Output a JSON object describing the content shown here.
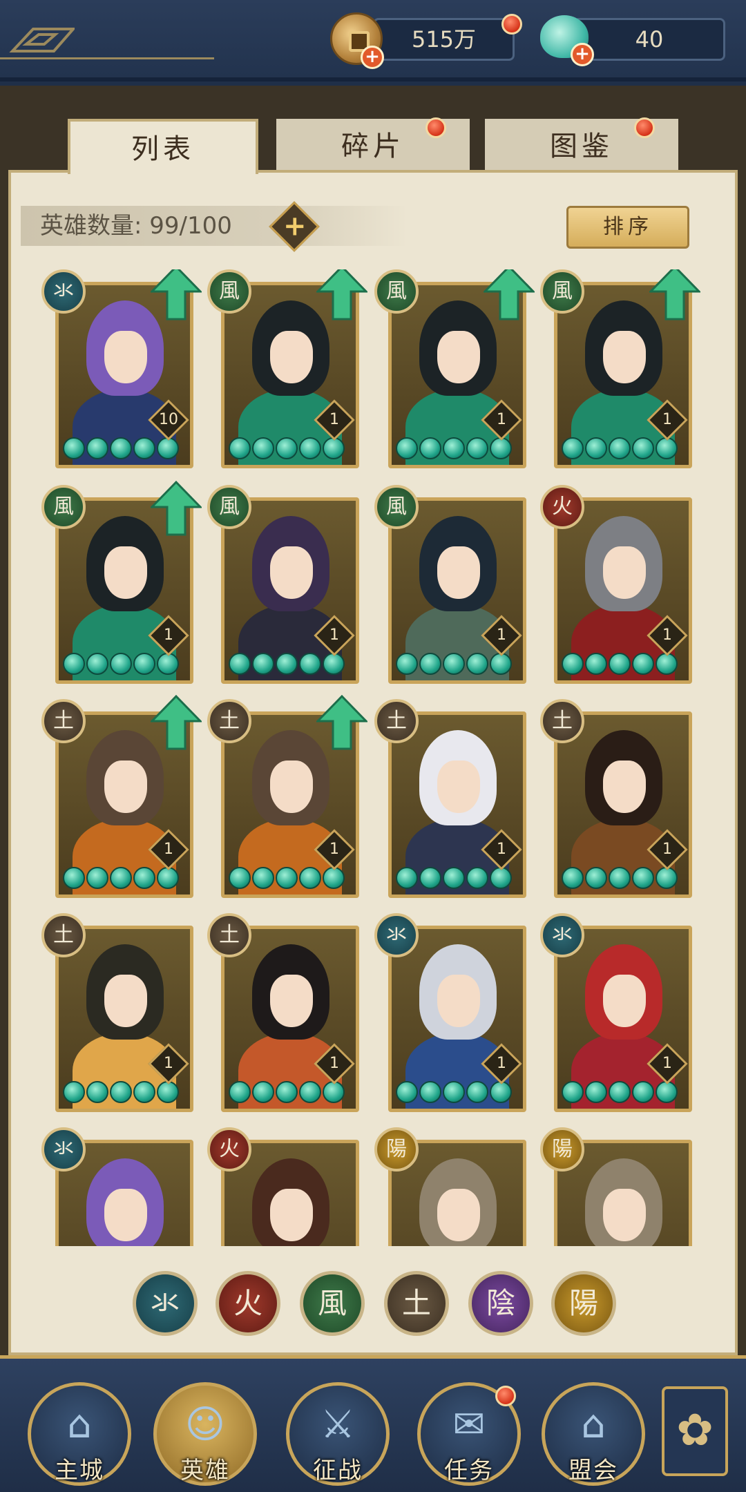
{
  "topbar": {
    "menu_icon": "pattern-menu-icon",
    "coin": {
      "icon": "copper-coin-icon",
      "value": "515万"
    },
    "gem": {
      "icon": "jade-gem-icon",
      "value": "40"
    }
  },
  "tabs": [
    {
      "label": "列表",
      "active": true
    },
    {
      "label": "碎片",
      "active": false,
      "notify": true
    },
    {
      "label": "图鉴",
      "active": false,
      "notify": true
    }
  ],
  "hero_count": {
    "label": "英雄数量: 99/100"
  },
  "sort_label": "排序",
  "heroes": [
    {
      "faction": "氺",
      "faction_class": "f-water",
      "level": "10",
      "upgrade": true,
      "hair": "#7b5bb8",
      "body": "#283a6d"
    },
    {
      "faction": "風",
      "faction_class": "f-wind",
      "level": "1",
      "upgrade": true,
      "hair": "#1c2326",
      "body": "#1f8a69"
    },
    {
      "faction": "風",
      "faction_class": "f-wind",
      "level": "1",
      "upgrade": true,
      "hair": "#1c2326",
      "body": "#1f8a69"
    },
    {
      "faction": "風",
      "faction_class": "f-wind",
      "level": "1",
      "upgrade": true,
      "hair": "#1c2326",
      "body": "#1f8a69"
    },
    {
      "faction": "風",
      "faction_class": "f-wind",
      "level": "1",
      "upgrade": true,
      "hair": "#1c2326",
      "body": "#1f8a69"
    },
    {
      "faction": "風",
      "faction_class": "f-wind",
      "level": "1",
      "upgrade": false,
      "hair": "#3a2d4f",
      "body": "#2a2a3a"
    },
    {
      "faction": "風",
      "faction_class": "f-wind",
      "level": "1",
      "upgrade": false,
      "hair": "#1d2a36",
      "body": "#4f6a5a"
    },
    {
      "faction": "火",
      "faction_class": "f-fire",
      "level": "1",
      "upgrade": false,
      "hair": "#7d7f84",
      "body": "#8c1f1f"
    },
    {
      "faction": "土",
      "faction_class": "f-earth",
      "level": "1",
      "upgrade": true,
      "hair": "#5a4636",
      "body": "#c46a1f"
    },
    {
      "faction": "土",
      "faction_class": "f-earth",
      "level": "1",
      "upgrade": true,
      "hair": "#5a4636",
      "body": "#c46a1f"
    },
    {
      "faction": "土",
      "faction_class": "f-earth",
      "level": "1",
      "upgrade": false,
      "hair": "#e8e8ee",
      "body": "#2d3550"
    },
    {
      "faction": "土",
      "faction_class": "f-earth",
      "level": "1",
      "upgrade": false,
      "hair": "#2a1d16",
      "body": "#7a4a22"
    },
    {
      "faction": "土",
      "faction_class": "f-earth",
      "level": "1",
      "upgrade": false,
      "hair": "#2b2a22",
      "body": "#e0a64a"
    },
    {
      "faction": "土",
      "faction_class": "f-earth",
      "level": "1",
      "upgrade": false,
      "hair": "#1e1a1a",
      "body": "#c4582a"
    },
    {
      "faction": "氺",
      "faction_class": "f-water",
      "level": "1",
      "upgrade": false,
      "hair": "#cfd3dc",
      "body": "#2b4d8c"
    },
    {
      "faction": "氺",
      "faction_class": "f-water",
      "level": "1",
      "upgrade": false,
      "hair": "#b82a2a",
      "body": "#a4232e"
    },
    {
      "faction": "氺",
      "faction_class": "f-water",
      "level": "",
      "upgrade": false,
      "hair": "#7b5bb8",
      "body": "#283a6d"
    },
    {
      "faction": "火",
      "faction_class": "f-fire",
      "level": "",
      "upgrade": false,
      "hair": "#4a2a1e",
      "body": "#8c1f1f"
    },
    {
      "faction": "陽",
      "faction_class": "f-yang",
      "level": "",
      "upgrade": false,
      "hair": "#8f826c",
      "body": "#e8e1d0"
    },
    {
      "faction": "陽",
      "faction_class": "f-yang",
      "level": "",
      "upgrade": false,
      "hair": "#8f826c",
      "body": "#e8e1d0"
    }
  ],
  "filters": [
    {
      "label": "氺",
      "class": "f-water"
    },
    {
      "label": "火",
      "class": "f-fire"
    },
    {
      "label": "風",
      "class": "f-wind"
    },
    {
      "label": "土",
      "class": "f-earth"
    },
    {
      "label": "陰",
      "class": "f-yin"
    },
    {
      "label": "陽",
      "class": "f-yang"
    }
  ],
  "nav": [
    {
      "label": "主城",
      "icon": "palace-icon",
      "active": false
    },
    {
      "label": "英雄",
      "icon": "hero-icon",
      "active": true
    },
    {
      "label": "征战",
      "icon": "battle-icon",
      "active": false
    },
    {
      "label": "任务",
      "icon": "quest-scroll-icon",
      "active": false,
      "notify": true
    },
    {
      "label": "盟会",
      "icon": "alliance-pavilion-icon",
      "active": false
    }
  ],
  "nav_extra_icon": "flower-menu-icon",
  "colors": {
    "accent_gold": "#c8a55a",
    "upgrade_green": "#3fbf85",
    "notify_red": "#d63319"
  }
}
